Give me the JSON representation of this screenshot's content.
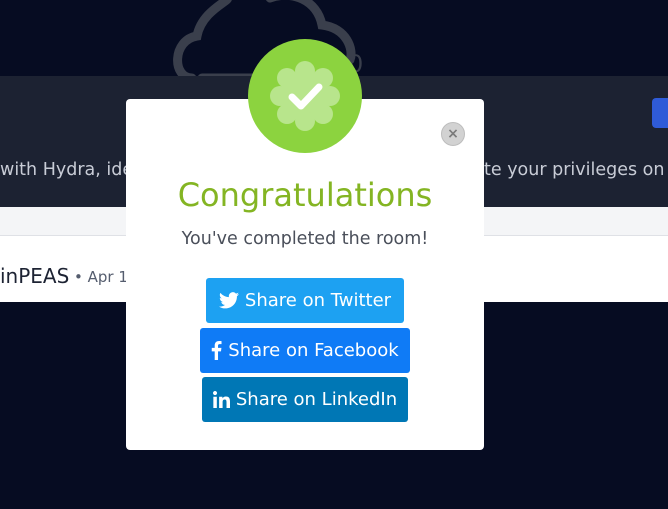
{
  "background": {
    "description_left": "with Hydra, ide",
    "description_right": "te your privileges on t",
    "author_name": "inPEAS",
    "author_date": "• Apr 1"
  },
  "modal": {
    "title": "Congratulations",
    "subtitle": "You've completed the room!",
    "close_symbol": "×",
    "share_buttons": [
      {
        "label": "Share on Twitter",
        "icon": "twitter-icon",
        "color": "#1da1f2"
      },
      {
        "label": "Share on Facebook",
        "icon": "facebook-icon",
        "color": "#0f7bf6"
      },
      {
        "label": "Share on LinkedIn",
        "icon": "linkedin-icon",
        "color": "#0077b5"
      }
    ],
    "badge_color": "#8cd33f",
    "title_color": "#84b523"
  }
}
